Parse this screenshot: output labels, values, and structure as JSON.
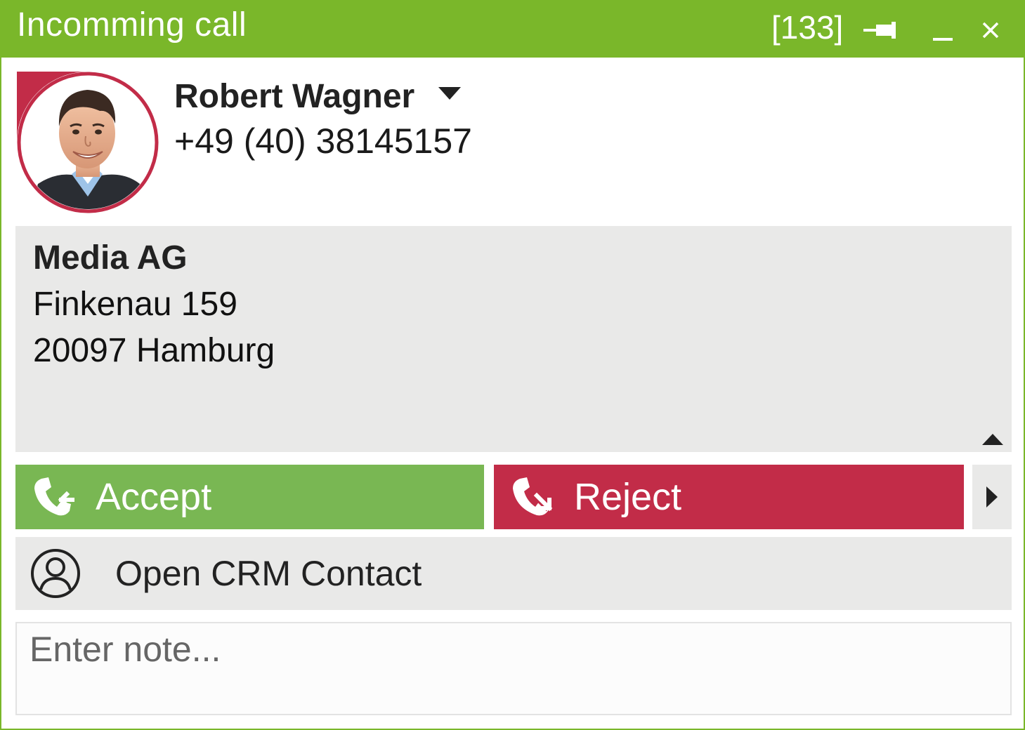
{
  "window": {
    "title": "Incomming call",
    "counter": "[133]",
    "accent_color": "#7ab72a",
    "controls": [
      "pin-icon",
      "minimize-icon",
      "close-icon"
    ]
  },
  "caller": {
    "name": "Robert Wagner",
    "phone": "+49 (40) 38145157",
    "avatar": "caller-photo",
    "avatar_ring_color": "#c22c48"
  },
  "address": {
    "company": "Media AG",
    "street": "Finkenau 159",
    "city": "20097 Hamburg"
  },
  "actions": {
    "accept_label": "Accept",
    "accept_color": "#79b753",
    "accept_icon": "phone-incoming-icon",
    "reject_label": "Reject",
    "reject_color": "#c22c48",
    "reject_icon": "phone-reject-icon",
    "more_icon": "chevron-right-icon"
  },
  "crm": {
    "label": "Open CRM Contact",
    "icon": "user-circle-icon"
  },
  "note": {
    "placeholder": "Enter note...",
    "value": ""
  }
}
